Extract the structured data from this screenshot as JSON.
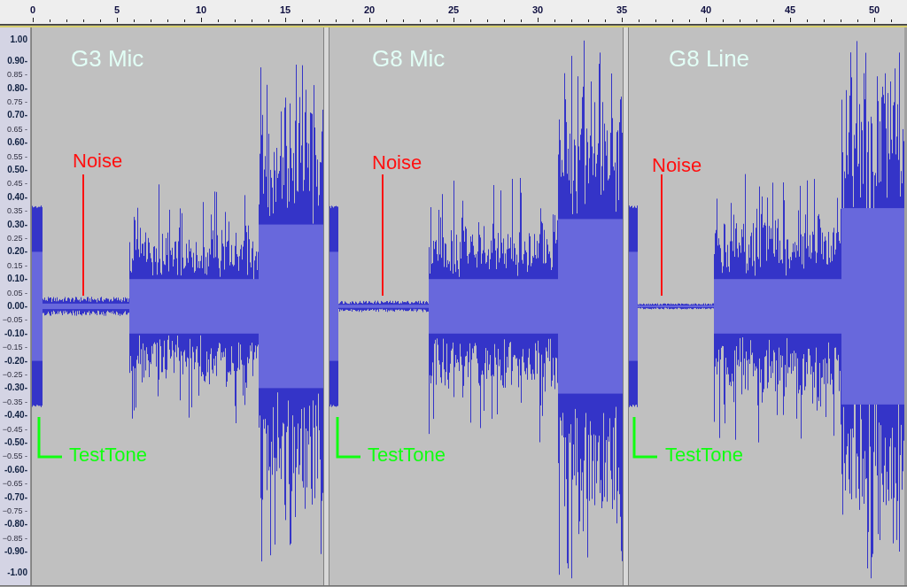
{
  "ruler": {
    "labels": [
      "0",
      "5",
      "10",
      "15",
      "20",
      "25",
      "30",
      "35",
      "40",
      "45",
      "50"
    ]
  },
  "amplitude_axis": {
    "labels": [
      {
        "text": "1.00",
        "major": true
      },
      {
        "text": "0.90-",
        "major": true
      },
      {
        "text": "0.85 -",
        "major": false
      },
      {
        "text": "0.80-",
        "major": true
      },
      {
        "text": "0.75 -",
        "major": false
      },
      {
        "text": "0.70-",
        "major": true
      },
      {
        "text": "0.65 -",
        "major": false
      },
      {
        "text": "0.60-",
        "major": true
      },
      {
        "text": "0.55 -",
        "major": false
      },
      {
        "text": "0.50-",
        "major": true
      },
      {
        "text": "0.45 -",
        "major": false
      },
      {
        "text": "0.40-",
        "major": true
      },
      {
        "text": "0.35 -",
        "major": false
      },
      {
        "text": "0.30-",
        "major": true
      },
      {
        "text": "0.25 -",
        "major": false
      },
      {
        "text": "0.20-",
        "major": true
      },
      {
        "text": "0.15 -",
        "major": false
      },
      {
        "text": "0.10-",
        "major": true
      },
      {
        "text": "0.05 -",
        "major": false
      },
      {
        "text": "0.00-",
        "major": true
      },
      {
        "text": "−0.05 -",
        "major": false
      },
      {
        "text": "-0.10-",
        "major": true
      },
      {
        "text": "−0.15 -",
        "major": false
      },
      {
        "text": "-0.20-",
        "major": true
      },
      {
        "text": "−0.25 -",
        "major": false
      },
      {
        "text": "-0.30-",
        "major": true
      },
      {
        "text": "−0.35 -",
        "major": false
      },
      {
        "text": "-0.40-",
        "major": true
      },
      {
        "text": "−0.45 -",
        "major": false
      },
      {
        "text": "-0.50-",
        "major": true
      },
      {
        "text": "−0.55 -",
        "major": false
      },
      {
        "text": "-0.60-",
        "major": true
      },
      {
        "text": "−0.65 -",
        "major": false
      },
      {
        "text": "-0.70-",
        "major": true
      },
      {
        "text": "−0.75 -",
        "major": false
      },
      {
        "text": "-0.80-",
        "major": true
      },
      {
        "text": "−0.85 -",
        "major": false
      },
      {
        "text": "-0.90-",
        "major": true
      },
      {
        "text": "-1.00",
        "major": true
      }
    ]
  },
  "clips": [
    {
      "title": "G3 Mic",
      "noise_label": "Noise",
      "tone_label": "TestTone"
    },
    {
      "title": "G8 Mic",
      "noise_label": "Noise",
      "tone_label": "TestTone"
    },
    {
      "title": "G8 Line",
      "noise_label": "Noise",
      "tone_label": "TestTone"
    }
  ]
}
